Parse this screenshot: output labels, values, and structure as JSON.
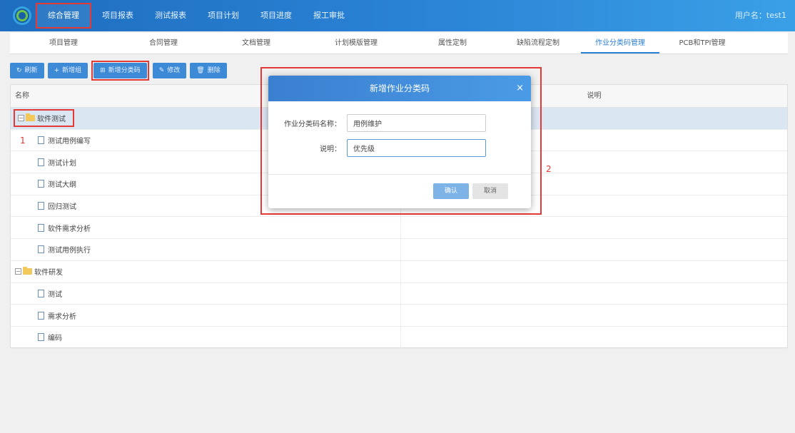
{
  "header": {
    "nav": [
      "综合管理",
      "项目报表",
      "测试报表",
      "项目计划",
      "项目进度",
      "报工审批"
    ],
    "user": "用户名：test1"
  },
  "subtabs": [
    "项目管理",
    "合同管理",
    "文档管理",
    "计划模版管理",
    "属性定制",
    "缺陷流程定制",
    "作业分类码管理",
    "PCB和TPI管理"
  ],
  "toolbar": {
    "refresh": "刷新",
    "add_group": "新增组",
    "add_code": "新增分类码",
    "edit": "修改",
    "delete": "删除"
  },
  "grid": {
    "columns": [
      "名称",
      "说明"
    ],
    "rows": [
      {
        "name": "软件测试",
        "type": "group"
      },
      {
        "name": "测试用例编写",
        "type": "item"
      },
      {
        "name": "测试计划",
        "type": "item"
      },
      {
        "name": "测试大纲",
        "type": "item"
      },
      {
        "name": "回归测试",
        "type": "item"
      },
      {
        "name": "软件需求分析",
        "type": "item"
      },
      {
        "name": "测试用例执行",
        "type": "item"
      },
      {
        "name": "软件研发",
        "type": "group"
      },
      {
        "name": "测试",
        "type": "item"
      },
      {
        "name": "需求分析",
        "type": "item"
      },
      {
        "name": "编码",
        "type": "item"
      }
    ]
  },
  "annotations": {
    "one": "1",
    "two": "2"
  },
  "dialog": {
    "title": "新增作业分类码",
    "name_label": "作业分类码名称：",
    "name_value": "用例维护",
    "desc_label": "说明：",
    "desc_value": "优先级",
    "ok": "确认",
    "cancel": "取消"
  },
  "colors": {
    "topbar": "#2b84d6",
    "button": "#3d8ad7",
    "highlight": "#e53935"
  }
}
